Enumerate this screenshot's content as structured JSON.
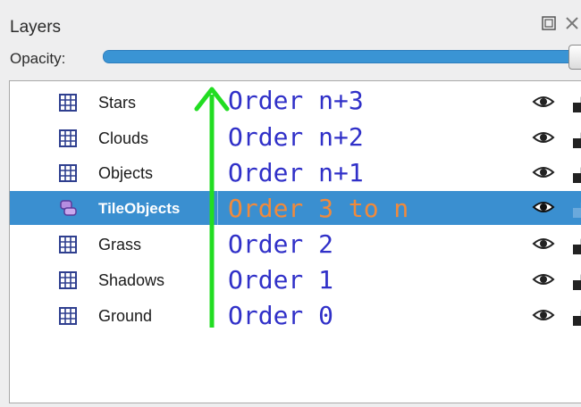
{
  "panel": {
    "title": "Layers",
    "opacity_label": "Opacity:",
    "opacity_value": 1.0,
    "accent_color": "#3a8fd0",
    "title_buttons": [
      "restore-icon",
      "close-icon"
    ]
  },
  "layers": [
    {
      "name": "Stars",
      "type": "tile-layer-icon",
      "visible": true,
      "locked": false,
      "selected": false
    },
    {
      "name": "Clouds",
      "type": "tile-layer-icon",
      "visible": true,
      "locked": false,
      "selected": false
    },
    {
      "name": "Objects",
      "type": "tile-layer-icon",
      "visible": true,
      "locked": false,
      "selected": false
    },
    {
      "name": "TileObjects",
      "type": "object-layer-icon",
      "visible": true,
      "locked": false,
      "selected": true
    },
    {
      "name": "Grass",
      "type": "tile-layer-icon",
      "visible": true,
      "locked": false,
      "selected": false
    },
    {
      "name": "Shadows",
      "type": "tile-layer-icon",
      "visible": true,
      "locked": false,
      "selected": false
    },
    {
      "name": "Ground",
      "type": "tile-layer-icon",
      "visible": true,
      "locked": false,
      "selected": false
    }
  ],
  "annotations": [
    {
      "text": "Order n+3",
      "color": "#3030c8"
    },
    {
      "text": "Order n+2",
      "color": "#3030c8"
    },
    {
      "text": "Order n+1",
      "color": "#3030c8"
    },
    {
      "text": "Order 3 to n",
      "color": "#f08a3c"
    },
    {
      "text": "Order 2",
      "color": "#3030c8"
    },
    {
      "text": "Order 1",
      "color": "#3030c8"
    },
    {
      "text": "Order 0",
      "color": "#3030c8"
    }
  ],
  "arrow": {
    "color": "#22dd22",
    "direction": "up"
  }
}
